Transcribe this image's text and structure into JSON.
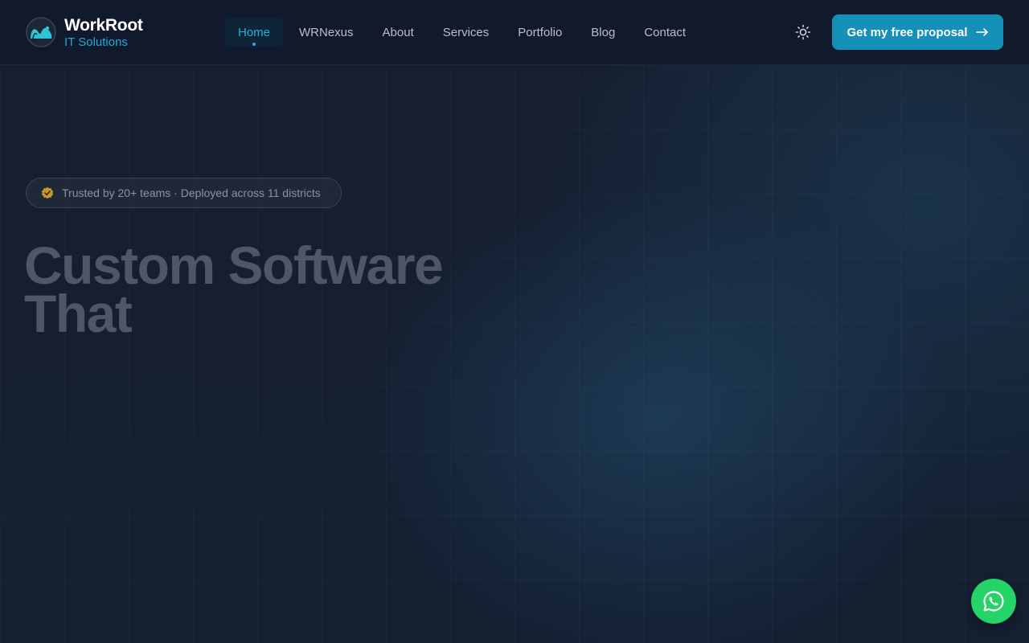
{
  "brand": {
    "name": "WorkRoot",
    "subtitle": "IT Solutions",
    "accent_color": "#22a9d6"
  },
  "nav": {
    "items": [
      {
        "label": "Home",
        "active": true
      },
      {
        "label": "WRNexus",
        "active": false
      },
      {
        "label": "About",
        "active": false
      },
      {
        "label": "Services",
        "active": false
      },
      {
        "label": "Portfolio",
        "active": false
      },
      {
        "label": "Blog",
        "active": false
      },
      {
        "label": "Contact",
        "active": false
      }
    ]
  },
  "header": {
    "theme_toggle_icon": "sun-icon",
    "cta_label": "Get my free proposal",
    "cta_icon": "arrow-right-icon",
    "cta_color": "#1590b6"
  },
  "hero": {
    "badge_icon": "verified-check-icon",
    "badge_text": "Trusted by 20+ teams · Deployed across 11 districts",
    "title_lines": [
      "Custom Software",
      "That"
    ]
  },
  "floating": {
    "whatsapp_icon": "whatsapp-icon",
    "whatsapp_color": "#25d366"
  }
}
